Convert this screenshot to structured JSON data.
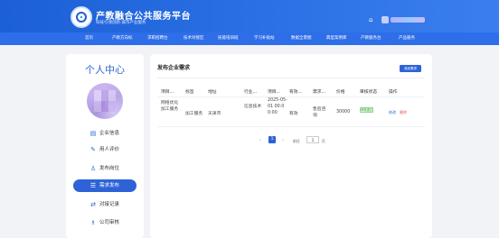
{
  "header": {
    "title": "产教融合公共服务平台",
    "subtitle": "科技引领创新·城市产业服务"
  },
  "nav": {
    "items": [
      "首页",
      "产教方向标",
      "求职招聘台",
      "技术对接区",
      "技能培训班",
      "学习补贴站",
      "数据全景图",
      "典型案例库",
      "产教服务台",
      "产品服务"
    ]
  },
  "sidebar": {
    "title": "个人中心",
    "items": [
      {
        "label": "企业信息",
        "icon": "document-icon"
      },
      {
        "label": "用人评价",
        "icon": "edit-icon"
      },
      {
        "label": "发布岗位",
        "icon": "user-icon"
      },
      {
        "label": "需求发布",
        "icon": "list-icon"
      },
      {
        "label": "对接记录",
        "icon": "link-icon"
      },
      {
        "label": "公司审核",
        "icon": "user-check-icon"
      }
    ],
    "active": "需求发布"
  },
  "main": {
    "title": "发布企业需求",
    "add_button": "添加需求",
    "columns": [
      "项目...",
      "标签",
      "地址",
      "行业...",
      "项目...",
      "有效...",
      "需求...",
      "价格",
      "审核状态",
      "操作"
    ],
    "rows": [
      {
        "project": "网络优化加工服务",
        "tag": "加工服务",
        "address": "天津市",
        "industry": "信息技术",
        "date": "2025-05-01 00:00:00",
        "validity": "有效",
        "demand": "售后咨询",
        "price": "30000",
        "status": "审核通过",
        "edit": "修改",
        "delete": "删除"
      }
    ],
    "pagination": {
      "prev": "‹",
      "current": "1",
      "next": "›",
      "goto_label": "前往",
      "goto_value": "1",
      "unit": "页"
    }
  },
  "colors": {
    "primary": "#2e63d8",
    "header": "#1c5fd6",
    "background": "#f2f3f7"
  }
}
